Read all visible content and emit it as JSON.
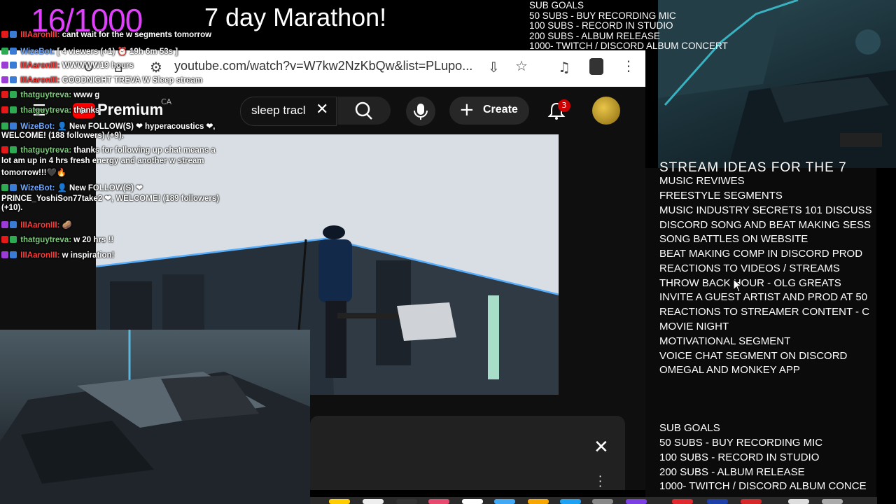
{
  "overlay": {
    "counter": "16/1000",
    "marathon_title": "7 day Marathon!",
    "top_goals": [
      "SUB GOALS",
      "50 SUBS - BUY RECORDING MIC",
      "100 SUBS - RECORD IN STUDIO",
      "200 SUBS - ALBUM RELEASE",
      "1000- TWITCH / DISCORD ALBUM CONCERT"
    ]
  },
  "browser": {
    "url": "youtube.com/watch?v=W7kw2NzKbQw&list=PLupo..."
  },
  "youtube": {
    "logo_text": "Premium",
    "country": "CA",
    "search_value": "sleep tracl",
    "create_label": "Create",
    "notification_count": "3"
  },
  "chat": [
    {
      "user": "IIIAaronIII:",
      "text": "cant wait for the w segments tomorrow",
      "color": "red"
    },
    {
      "user": "WizeBot:",
      "text": "[ 4 viewers (+1) ⏰ 19h 6m 53s ]",
      "color": "blue"
    },
    {
      "user": "IIIAaronIII:",
      "text": "WWWWW19 hours",
      "color": "red"
    },
    {
      "user": "IIIAaronIII:",
      "text": "GOODNIGHT TREVA W Sleep stream",
      "color": "red"
    },
    {
      "user": "thatguytreva:",
      "text": "www g",
      "color": "green"
    },
    {
      "user": "thatguytreva:",
      "text": "thanks",
      "color": "green"
    },
    {
      "user": "WizeBot:",
      "text": "👤 New FOLLOW(S) ❤ hyperacoustics ❤,",
      "color": "blue"
    },
    {
      "user": "",
      "text": "WELCOME! (188 followers) (+9).",
      "color": ""
    },
    {
      "user": "thatguytreva:",
      "text": "thanks for following up chat means a",
      "color": "green"
    },
    {
      "user": "",
      "text": "lot am up in 4 hrs fresh energy and another w stream",
      "color": ""
    },
    {
      "user": "",
      "text": "tomorrow!!!🖤🔥",
      "color": ""
    },
    {
      "user": "WizeBot:",
      "text": "👤 New FOLLOW(S) ❤",
      "color": "blue"
    },
    {
      "user": "",
      "text": "PRINCE_YoshiSon77take2 ❤, WELCOME! (189 followers)",
      "color": ""
    },
    {
      "user": "",
      "text": "(+10).",
      "color": ""
    },
    {
      "user": "IIIAaronIII:",
      "text": "🥔",
      "color": "red"
    },
    {
      "user": "thatguytreva:",
      "text": "w 20 hrs !!",
      "color": "green"
    },
    {
      "user": "IIIAaronIII:",
      "text": "w inspiration!",
      "color": "red"
    }
  ],
  "stream_ideas": {
    "heading": "STREAM IDEAS FOR THE 7",
    "items": [
      "MUSIC REVIWES",
      "FREESTYLE SEGMENTS",
      "MUSIC INDUSTRY SECRETS 101 DISCUSS",
      "DISCORD SONG AND BEAT MAKING SESS",
      "SONG BATTLES ON WEBSITE",
      "BEAT MAKING COMP IN  DISCORD PROD",
      "REACTIONS TO VIDEOS / STREAMS",
      "THROW BACK HOUR - OLG GREATS",
      "INVITE A GUEST ARTIST AND PROD AT 50",
      "REACTIONS TO STREAMER CONTENT - C",
      "MOVIE NIGHT",
      "MOTIVATIONAL SEGMENT",
      "VOICE CHAT SEGMENT ON DISCORD",
      "OMEGAL AND MONKEY APP"
    ],
    "goals": [
      "SUB GOALS",
      "50 SUBS - BUY RECORDING MIC",
      "100 SUBS - RECORD IN STUDIO",
      "200 SUBS - ALBUM RELEASE",
      "1000- TWITCH / DISCORD ALBUM CONCE"
    ]
  },
  "colors": {
    "counter": "#e040fb",
    "youtube_red": "#ff0000",
    "badge_red": "#cc0000"
  }
}
